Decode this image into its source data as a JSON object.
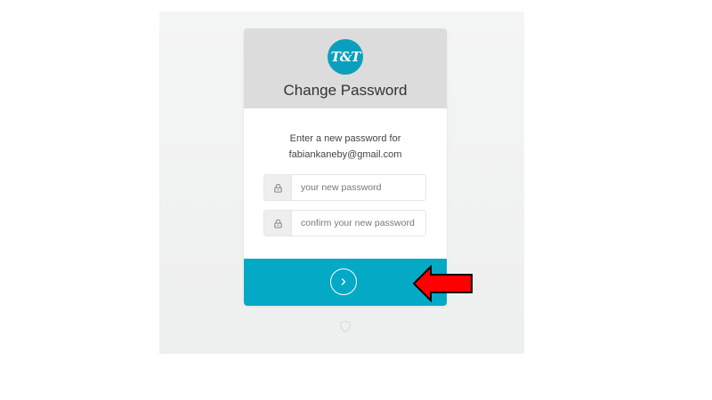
{
  "header": {
    "logo_text": "T&T",
    "title": "Change Password"
  },
  "prompt": {
    "line1": "Enter a new password for",
    "email": "fabiankaneby@gmail.com"
  },
  "fields": {
    "new_password": {
      "placeholder": "your new password",
      "value": ""
    },
    "confirm_password": {
      "placeholder": "confirm your new password",
      "value": ""
    }
  },
  "submit": {
    "icon": "chevron-right-icon"
  },
  "annotation": {
    "icon": "red-arrow-left",
    "color": "#ff0000"
  },
  "colors": {
    "accent": "#04a9c6",
    "logo": "#0aa0bd",
    "header_bg": "#dcdcdc"
  }
}
